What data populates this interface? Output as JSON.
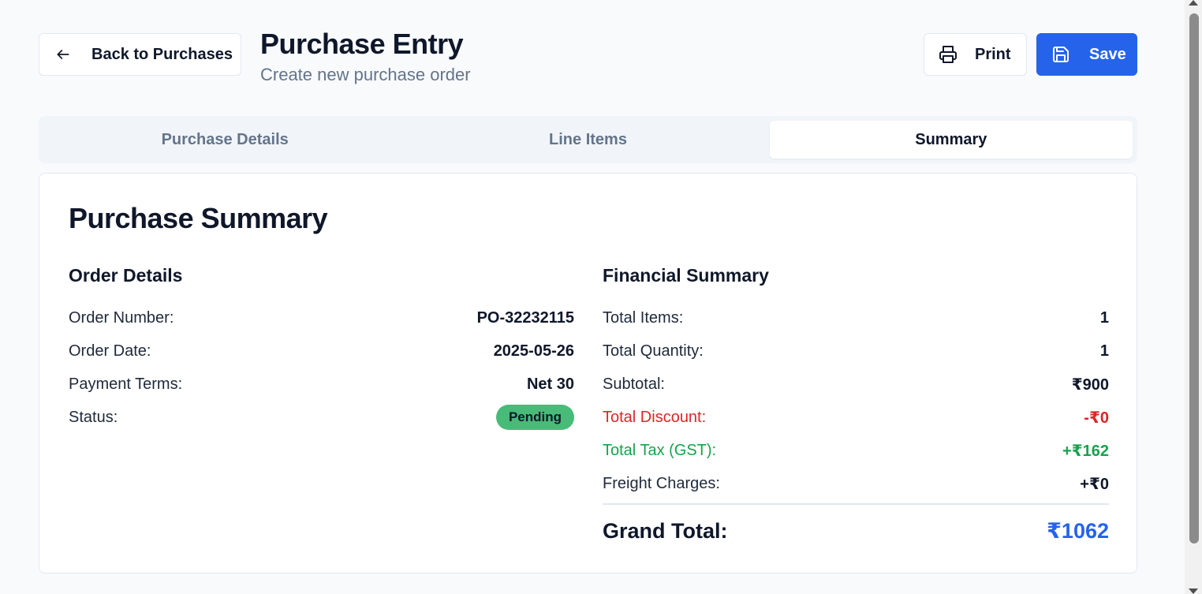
{
  "header": {
    "back_label": "Back to Purchases",
    "title": "Purchase Entry",
    "subtitle": "Create new purchase order",
    "print_label": "Print",
    "save_label": "Save"
  },
  "tabs": [
    {
      "label": "Purchase Details",
      "active": false
    },
    {
      "label": "Line Items",
      "active": false
    },
    {
      "label": "Summary",
      "active": true
    }
  ],
  "summary": {
    "title": "Purchase Summary",
    "order_details": {
      "title": "Order Details",
      "rows": [
        {
          "label": "Order Number:",
          "value": "PO-32232115"
        },
        {
          "label": "Order Date:",
          "value": "2025-05-26"
        },
        {
          "label": "Payment Terms:",
          "value": "Net 30"
        },
        {
          "label": "Status:",
          "value": "Pending"
        }
      ]
    },
    "financial": {
      "title": "Financial Summary",
      "rows": [
        {
          "label": "Total Items:",
          "value": "1"
        },
        {
          "label": "Total Quantity:",
          "value": "1"
        },
        {
          "label": "Subtotal:",
          "value": "₹900"
        },
        {
          "label": "Total Discount:",
          "value": "-₹0"
        },
        {
          "label": "Total Tax (GST):",
          "value": "+₹162"
        },
        {
          "label": "Freight Charges:",
          "value": "+₹0"
        }
      ],
      "grand_total_label": "Grand Total:",
      "grand_total_value": "₹1062"
    }
  },
  "colors": {
    "primary": "#2563eb",
    "discount": "#dc2626",
    "tax": "#16a34a",
    "status_badge": "#48bb78"
  },
  "icons": {
    "back": "arrow-left-icon",
    "print": "printer-icon",
    "save": "save-icon"
  }
}
